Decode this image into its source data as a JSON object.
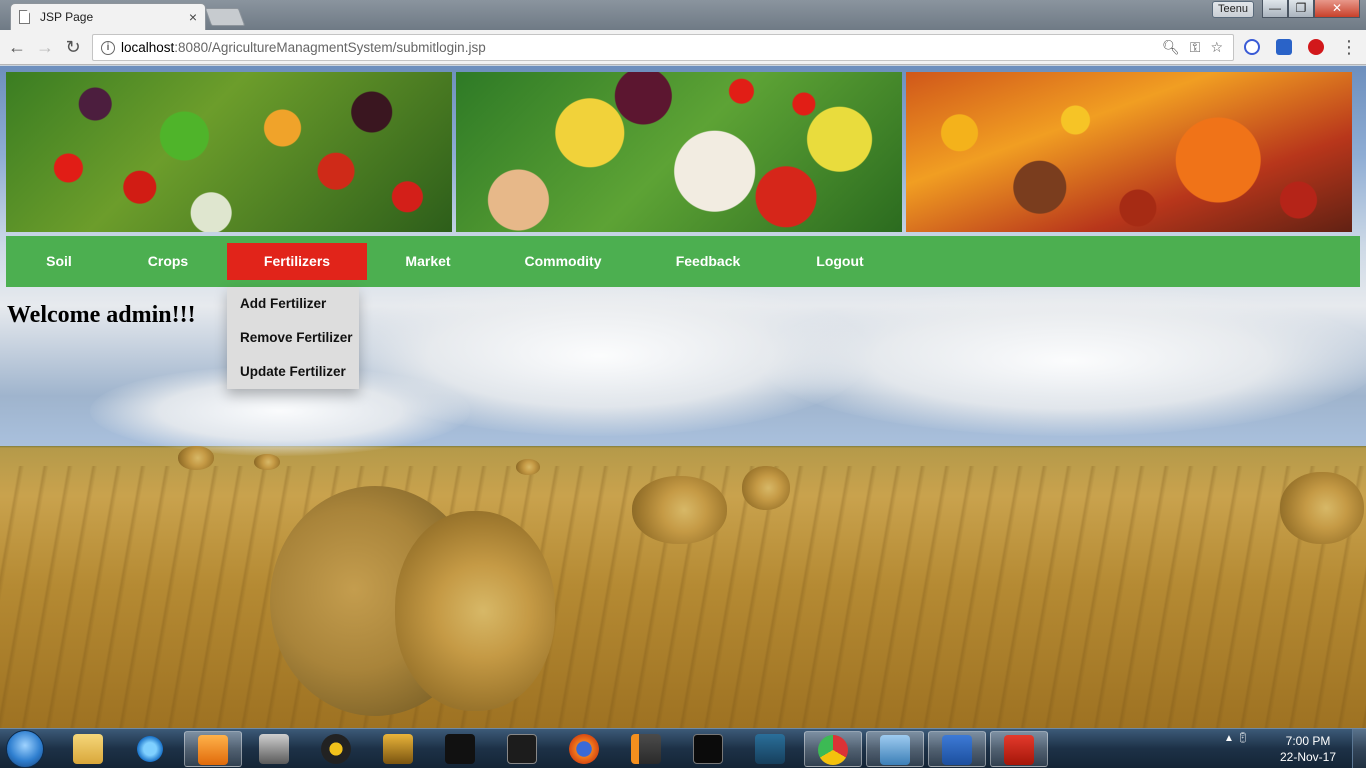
{
  "browser": {
    "tab_title": "JSP Page",
    "tab_close": "×",
    "user_chip": "Teenu",
    "url_host": "localhost",
    "url_path": ":8080/AgricultureManagmentSystem/submitlogin.jsp",
    "back": "←",
    "forward": "→",
    "reload": "↻",
    "menu": "⋮",
    "minimize": "—",
    "maximize": "❐",
    "close": "✕"
  },
  "nav": {
    "items": [
      {
        "label": "Soil"
      },
      {
        "label": "Crops"
      },
      {
        "label": "Fertilizers"
      },
      {
        "label": "Market"
      },
      {
        "label": "Commodity"
      },
      {
        "label": "Feedback"
      },
      {
        "label": "Logout"
      }
    ],
    "active_index": 2,
    "bar_color": "#4caf50",
    "active_color": "#e1241a"
  },
  "dropdown": {
    "items": [
      {
        "label": "Add Fertilizer"
      },
      {
        "label": "Remove Fertilizer"
      },
      {
        "label": "Update Fertilizer"
      }
    ]
  },
  "welcome_text": "Welcome admin!!!",
  "taskbar": {
    "apps": [
      {
        "name": "windows-explorer-icon"
      },
      {
        "name": "internet-explorer-icon"
      },
      {
        "name": "media-player-icon"
      },
      {
        "name": "game-icon"
      },
      {
        "name": "pes-15-icon"
      },
      {
        "name": "counter-strike-icon"
      },
      {
        "name": "wwe-icon"
      },
      {
        "name": "sleeping-dogs-icon"
      },
      {
        "name": "firefox-icon"
      },
      {
        "name": "sublime-text-icon"
      },
      {
        "name": "mysql-console-icon"
      },
      {
        "name": "mysql-workbench-icon"
      },
      {
        "name": "chrome-icon"
      },
      {
        "name": "virtualbox-icon"
      },
      {
        "name": "word-icon"
      },
      {
        "name": "acrobat-icon"
      }
    ],
    "time": "7:00 PM",
    "date": "22-Nov-17"
  }
}
